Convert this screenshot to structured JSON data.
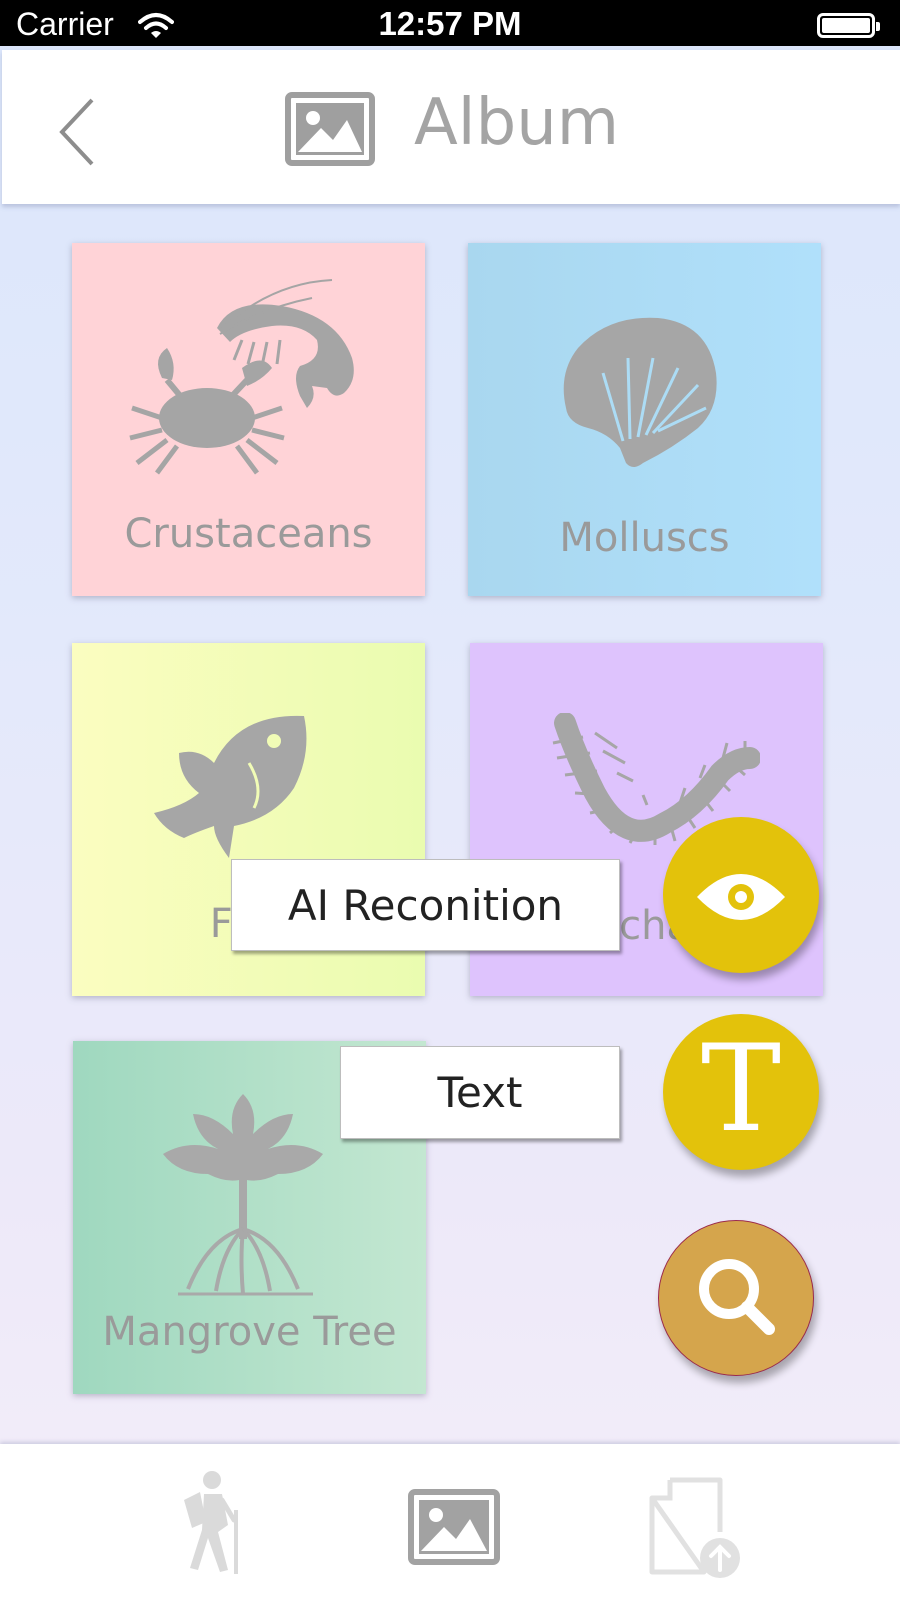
{
  "status_bar": {
    "carrier": "Carrier",
    "time": "12:57 PM"
  },
  "header": {
    "title": "Album",
    "back_icon": "chevron-left-icon",
    "title_icon": "image-icon"
  },
  "categories": [
    {
      "label": "Crustaceans",
      "icon": "crab-shrimp-icon",
      "color": "#ffd3d7"
    },
    {
      "label": "Molluscs",
      "icon": "shell-icon",
      "color": "#abdbf3"
    },
    {
      "label": "Fish",
      "icon": "fish-icon",
      "color": "#f3fcb8"
    },
    {
      "label": "Polychaeta",
      "icon": "worm-icon",
      "color": "#dec3fd"
    },
    {
      "label": "Mangrove Tree",
      "icon": "mangrove-icon",
      "color": "#b0e0c8"
    }
  ],
  "menu": {
    "ai_label": "AI Reconition",
    "text_label": "Text",
    "text_fab_glyph": "T",
    "fab_yellow": "#e3c20b",
    "fab_search": "#d5a54c"
  },
  "tabbar": {
    "items": [
      "hiker-icon",
      "image-icon",
      "upload-document-icon"
    ]
  }
}
